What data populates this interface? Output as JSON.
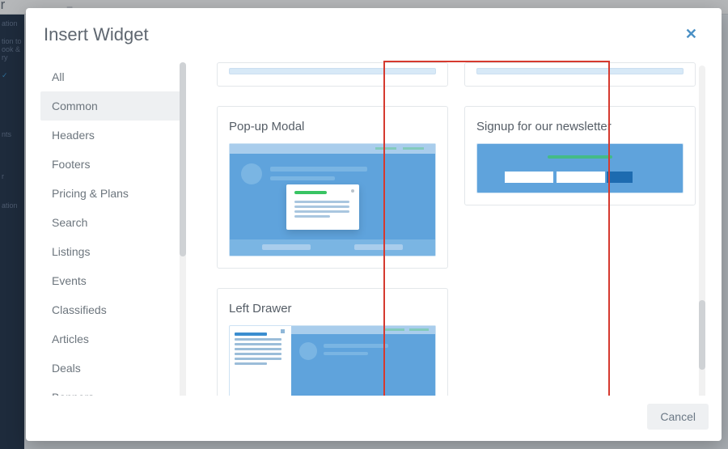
{
  "background": {
    "app_name_partial": "ctor"
  },
  "modal": {
    "title": "Insert Widget",
    "close_glyph": "✕",
    "footer": {
      "cancel": "Cancel"
    }
  },
  "sidebar": {
    "active_index": 1,
    "items": [
      {
        "label": "All"
      },
      {
        "label": "Common"
      },
      {
        "label": "Headers"
      },
      {
        "label": "Footers"
      },
      {
        "label": "Pricing & Plans"
      },
      {
        "label": "Search"
      },
      {
        "label": "Listings"
      },
      {
        "label": "Events"
      },
      {
        "label": "Classifieds"
      },
      {
        "label": "Articles"
      },
      {
        "label": "Deals"
      },
      {
        "label": "Banners"
      }
    ]
  },
  "widgets": {
    "col1": [
      {
        "title": "Pop-up Modal",
        "thumb": "popup"
      },
      {
        "title": "Left Drawer",
        "thumb": "drawer"
      }
    ],
    "col2": [
      {
        "title": "Signup for our newsletter",
        "thumb": "newsletter"
      }
    ]
  }
}
